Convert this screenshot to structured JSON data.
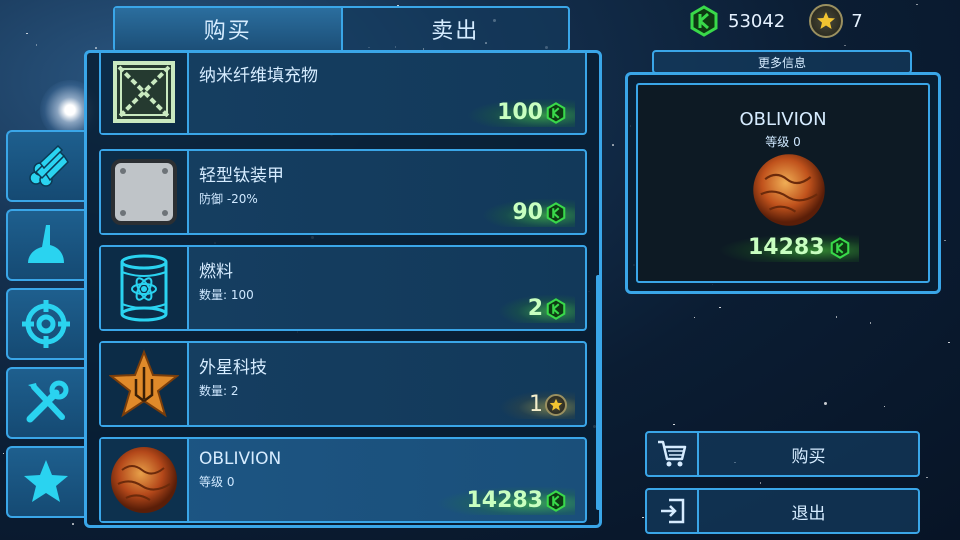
{
  "tabs": {
    "buy": "购买",
    "sell": "卖出"
  },
  "currency": {
    "crystals": "53042",
    "stars": "7"
  },
  "categories": [
    {
      "icon": "parts-icon"
    },
    {
      "icon": "hull-icon"
    },
    {
      "icon": "weapons-icon"
    },
    {
      "icon": "tools-icon"
    },
    {
      "icon": "special-icon"
    }
  ],
  "items": [
    {
      "name": "纳米纤维填充物",
      "sub": "",
      "price": "100",
      "currency": "crystal",
      "icon": "crate-icon"
    },
    {
      "name": "轻型钛装甲",
      "sub": "防御 -20%",
      "price": "90",
      "currency": "crystal",
      "icon": "armor-plate-icon"
    },
    {
      "name": "燃料",
      "sub": "数量: 100",
      "price": "2",
      "currency": "crystal",
      "icon": "fuel-barrel-icon"
    },
    {
      "name": "外星科技",
      "sub": "数量: 2",
      "price": "1",
      "currency": "star",
      "icon": "alien-tech-icon"
    },
    {
      "name": "OBLIVION",
      "sub": "等级 0",
      "price": "14283",
      "currency": "crystal",
      "icon": "oblivion-orb-icon"
    }
  ],
  "info": {
    "header": "更多信息",
    "title": "OBLIVION",
    "level": "等级 0",
    "price": "14283"
  },
  "actions": {
    "buy": "购买",
    "exit": "退出"
  },
  "colors": {
    "accent": "#3aa6e8",
    "crystal": "#39d94a",
    "gold": "#f2c431"
  }
}
